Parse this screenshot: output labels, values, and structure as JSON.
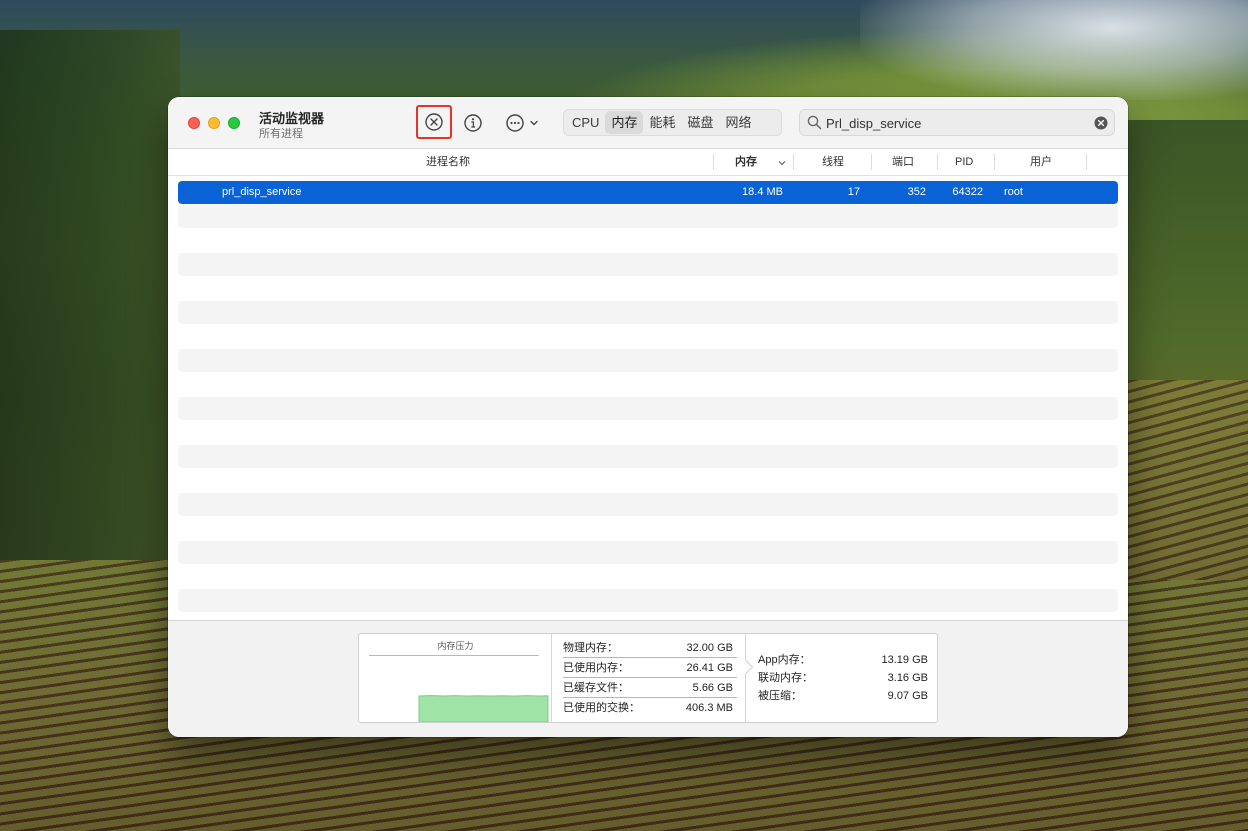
{
  "window": {
    "title": "活动监视器",
    "subtitle": "所有进程"
  },
  "toolbar": {
    "stop_icon": "stop-process-icon",
    "info_icon": "info-icon",
    "more_icon": "ellipsis-icon"
  },
  "tabs": [
    {
      "label": "CPU",
      "active": false
    },
    {
      "label": "内存",
      "active": true
    },
    {
      "label": "能耗",
      "active": false
    },
    {
      "label": "磁盘",
      "active": false
    },
    {
      "label": "网络",
      "active": false
    }
  ],
  "search": {
    "value": "Prl_disp_service"
  },
  "table": {
    "headers": {
      "process_name": "进程名称",
      "memory": "内存",
      "threads": "线程",
      "ports": "端口",
      "pid": "PID",
      "user": "用户"
    },
    "rows": [
      {
        "name": "prl_disp_service",
        "memory": "18.4 MB",
        "threads": "17",
        "ports": "352",
        "pid": "64322",
        "user": "root",
        "selected": true
      }
    ]
  },
  "memory_panel": {
    "pressure_label": "内存压力",
    "pressure_color": "#9fe3a6",
    "physical_label": "物理内存：",
    "physical_value": "32.00 GB",
    "used_label": "已使用内存：",
    "used_value": "26.41 GB",
    "cached_label": "已缓存文件：",
    "cached_value": "5.66 GB",
    "swap_label": "已使用的交换：",
    "swap_value": "406.3 MB",
    "app_label": "App内存：",
    "app_value": "13.19 GB",
    "wired_label": "联动内存：",
    "wired_value": "3.16 GB",
    "compressed_label": "被压缩：",
    "compressed_value": "9.07 GB"
  },
  "colors": {
    "selection": "#0a63d6",
    "highlight_border": "#e8322c"
  }
}
